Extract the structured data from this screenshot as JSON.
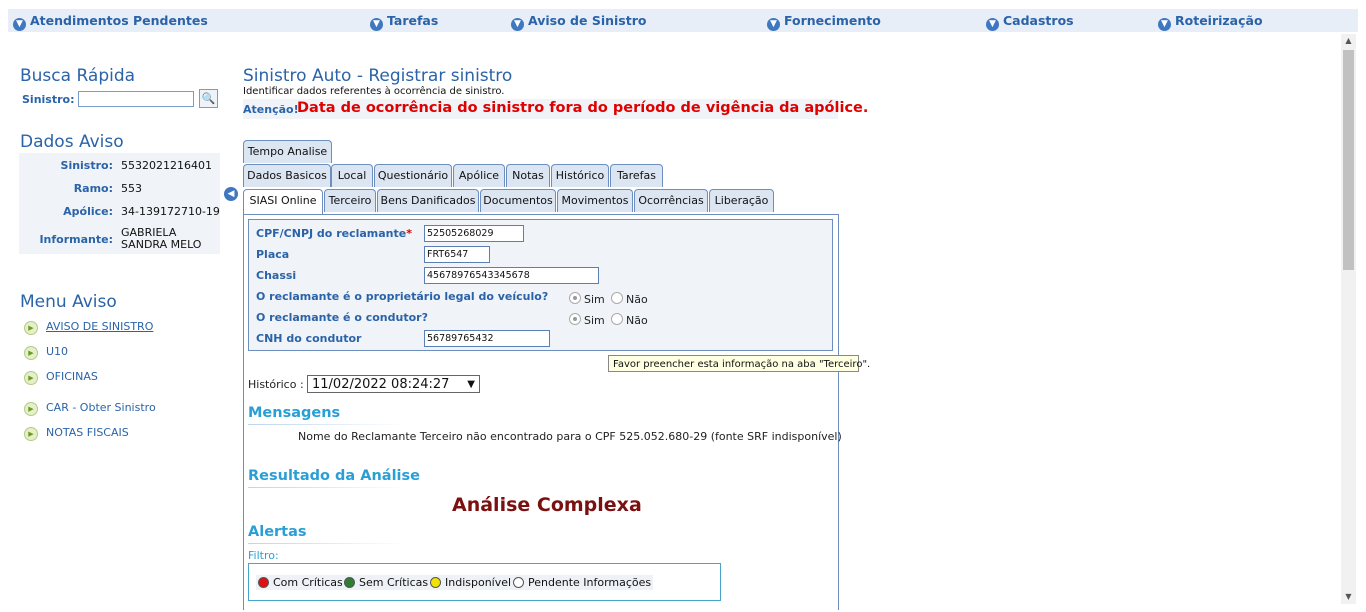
{
  "topnav": [
    {
      "label": "Atendimentos Pendentes"
    },
    {
      "label": "Tarefas"
    },
    {
      "label": "Aviso de Sinistro"
    },
    {
      "label": "Fornecimento"
    },
    {
      "label": "Cadastros"
    },
    {
      "label": "Roteirização"
    }
  ],
  "busca": {
    "title": "Busca Rápida",
    "sinistro_label": "Sinistro:",
    "value": ""
  },
  "dados": {
    "title": "Dados Aviso",
    "rows": [
      {
        "k": "Sinistro:",
        "v": "5532021216401"
      },
      {
        "k": "Ramo:",
        "v": "553"
      },
      {
        "k": "Apólice:",
        "v": "34-139172710-19"
      },
      {
        "k": "Informante:",
        "v": "GABRIELA SANDRA MELO"
      }
    ]
  },
  "menu": {
    "title": "Menu Aviso",
    "items": [
      {
        "label": "AVISO DE SINISTRO"
      },
      {
        "label": "U10"
      },
      {
        "label": "OFICINAS"
      },
      {
        "label": "CAR - Obter Sinistro"
      },
      {
        "label": "NOTAS FISCAIS"
      }
    ]
  },
  "main": {
    "title": "Sinistro Auto - Registrar sinistro",
    "subtitle": "Identificar dados referentes à ocorrência de sinistro.",
    "warn_label": "Atenção!",
    "warn_msg": "Data de ocorrência do sinistro fora do período de vigência da apólice."
  },
  "tabs": {
    "row1": [
      "Tempo Analise"
    ],
    "row2": [
      "Dados Basicos",
      "Local",
      "Questionário",
      "Apólice",
      "Notas",
      "Histórico",
      "Tarefas"
    ],
    "row3": [
      "SIASI Online",
      "Terceiro",
      "Bens Danificados",
      "Documentos",
      "Movimentos",
      "Ocorrências",
      "Liberação"
    ],
    "active": "SIASI Online"
  },
  "form": {
    "cpf_label": "CPF/CNPJ do reclamante",
    "cpf_required": "*",
    "cpf_value": "52505268029",
    "placa_label": "Placa",
    "placa_value": "FRT6547",
    "chassi_label": "Chassi",
    "chassi_value": "45678976543345678",
    "prop_label": "O reclamante é o proprietário legal do veículo?",
    "cond_label": "O reclamante é o condutor?",
    "sim": "Sim",
    "nao": "Não",
    "cnh_label": "CNH do condutor",
    "cnh_value": "56789765432"
  },
  "tooltip": "Favor preencher esta informação na aba \"Terceiro\".",
  "historico": {
    "label": "Histórico :",
    "value": "11/02/2022 08:24:27"
  },
  "mensagens": {
    "title": "Mensagens",
    "text": "Nome do Reclamante Terceiro não encontrado para o CPF 525.052.680-29 (fonte SRF indisponível)"
  },
  "resultado": {
    "title": "Resultado da Análise",
    "value": "Análise Complexa"
  },
  "alertas": {
    "title": "Alertas",
    "filtro": "Filtro:",
    "items": [
      {
        "label": "Com Críticas",
        "color": "#e01010"
      },
      {
        "label": "Sem Críticas",
        "color": "#2e7d32"
      },
      {
        "label": "Indisponível",
        "color": "#f2e200"
      },
      {
        "label": "Pendente Informações",
        "color": "#ffffff"
      }
    ]
  }
}
